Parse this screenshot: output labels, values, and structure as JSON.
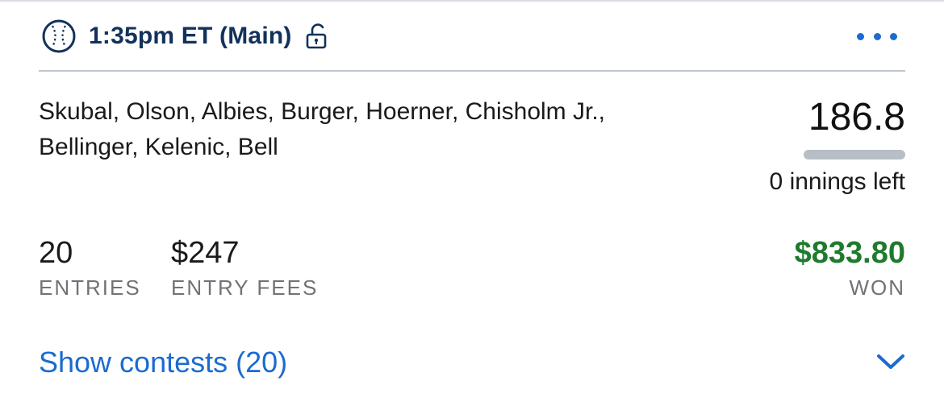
{
  "header": {
    "slate_title": "1:35pm ET (Main)",
    "sport_icon": "baseball-icon",
    "lock_icon": "unlocked-padlock-icon",
    "menu_icon": "more-horizontal-icon"
  },
  "lineup": {
    "players": "Skubal, Olson, Albies, Burger, Hoerner, Chisholm Jr., Bellinger, Kelenic, Bell",
    "score": "186.8",
    "innings_progress": 1.0,
    "innings_left": "0 innings left"
  },
  "stats": {
    "entries_value": "20",
    "entries_label": "ENTRIES",
    "fees_value": "$247",
    "fees_label": "ENTRY FEES",
    "won_value": "$833.80",
    "won_label": "WON"
  },
  "footer": {
    "show_contests_label": "Show contests (20)",
    "expand_icon": "chevron-down-icon"
  },
  "colors": {
    "title_navy": "#12325c",
    "accent_blue": "#1b6bd1",
    "won_green": "#1f7a2e",
    "label_gray": "#6f7378",
    "divider_gray": "#bfc5cc"
  }
}
